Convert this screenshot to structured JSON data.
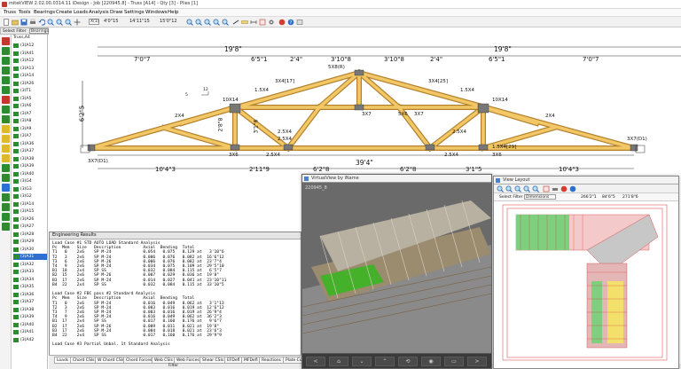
{
  "window": {
    "title": "mitekVIEW 2.02.00.0314.11 iDesign - Job [220945.8] - Truss [A14] - Qty [3] - Plies [1]"
  },
  "menu": [
    "Truss",
    "Tools",
    "Bearings",
    "Create",
    "Loads",
    "Analysis",
    "Draw",
    "Settings",
    "Windows",
    "Help"
  ],
  "toolbar": {
    "view": "X(1)",
    "coord_x": "4'0\"15",
    "coord_y": "14'11\"15",
    "coord_z": "15'0\"12"
  },
  "select_filter": {
    "label": "Select Filter",
    "value": "Bearings"
  },
  "tree": {
    "root": "Truss,A4",
    "items": [
      "(3)A12",
      "(3)A41",
      "(3)A12",
      "(3)A13",
      "(3)A14",
      "(3)A26",
      "(3)T1",
      "(3)A5",
      "(3)A6",
      "(3)A7",
      "(3)A8",
      "(3)A9",
      "(3)A7",
      "(3)A36",
      "(3)A37",
      "(3)A38",
      "(3)A39",
      "(3)A40",
      "(3)G4",
      "(3)G3",
      "(3)G2",
      "(3)A14",
      "(3)A15",
      "(3)A26",
      "(3)A27",
      "(3)A28",
      "(3)A29",
      "(3)A30",
      "(3)A31",
      "(3)A32",
      "(3)A33",
      "(3)A34",
      "(3)A35",
      "(3)A36",
      "(3)A37",
      "(3)A38",
      "(3)A39",
      "(3)A40",
      "(3)A41",
      "(3)A42"
    ],
    "selected_index": 28,
    "selected_label": "(3)A14"
  },
  "drawing": {
    "top_dims_left": [
      "19'8\"",
      "7'0\"7",
      "6'5\"1",
      "2'4\"",
      "3'10\"8"
    ],
    "top_dims_right": [
      "19'8\"",
      "3'10\"8",
      "2'4\"",
      "6'5\"1",
      "7'0\"7"
    ],
    "overall_bottom": "39'4\"",
    "bottom_dims": [
      "10'4\"3",
      "2'11\"9",
      "6'2\"8",
      "6'2\"8",
      "3'1\"5",
      "10'4\"3"
    ],
    "height_left": "6'2\"5",
    "height_inner": "2'8\"8",
    "height_mid": "3'1\"6",
    "pitch": "12",
    "pitch_rise": "5",
    "plates": [
      "5X8(R)",
      "3X4[17]",
      "3X4[25]",
      "1.5X4",
      "1.5X4",
      "10X14",
      "10X14",
      "2X4",
      "2X4",
      "3X7",
      "5X6",
      "3X7",
      "2.5X4",
      "2.5X4",
      "2.5X4",
      "2.5X4",
      "2.5X4",
      "3X6",
      "3X6",
      "1.5X4[29]",
      "3X7(D1)",
      "3X7(D1)"
    ]
  },
  "results": {
    "title": "Engineering Results",
    "text": "Load Case #1 STD AUTO LOAD Standard Analysis\nPc  Mem   Size   Description         Axial  Bending  Total\nT1   0    2x6    SP M-24             0.054   0.075   0.129 at   3'10\"6\nT2   3    2x6    SP M-24             0.006   0.076   0.082 at  16'6\"12\nT3   6    2x6    SP M-26             0.006   0.076   0.082 at  23'7\"4\nT4   9    2x6    SP M-24             0.034   0.075   0.109 at  29'5\"10\nB1  18    2x4    SP SS               0.032   0.084   0.115 at   6'5\"7\nB2  15    2x6    SP M-26             0.007   0.029   0.036 at  19'8\"\nB3  17    2x6    SP M-24             0.014   0.027   0.041 at  23'10\"11\nB4  22    2x4    SP SS               0.032   0.084   0.115 at  33'10\"5\n\nLoad Case #2 FBC pass #2 Standard Analysis\nPc  Mem   Size   Description         Axial  Bending  Total\nT1   0    2x6    SP M-24             0.016   0.049   0.062 at   3'1\"13\nT2   3    2x6    SP M-24             0.003   0.016   0.019 at  12'6\"12\nT3   7    2x6    SP M-24             0.003   0.016   0.019 at  26'9\"4\nT4   9    2x6    SP M-24             0.016   0.049   0.062 at  36'2\"3\nB1  17    2x4    SP SS               0.017   0.160   0.176 at   9'6\"7\nB2  17    2x6    SP M-26             0.009   0.011   0.021 at  19'8\"\nB3  17    2x6    SP M-24             0.004   0.018   0.021 at  23'6\"3\nB4  22    2x4    SP SS               0.017   0.160   0.176 at  29'9\"9\n\nLoad Case #3 Partial Unbal. 1t Standard Analysis"
  },
  "tabs": [
    "Loads",
    "Chord CSIs",
    "W Chord CSIs",
    "Chord Forces",
    "Web CSIs",
    "Web Forces",
    "Shear CSIs",
    "EFDefl",
    "MFDefl",
    "Reactions",
    "Plate Co"
  ],
  "status": {
    "filter": "Filter"
  },
  "virtual_view": {
    "title": "VirtualView by iName",
    "job_label": "220945_8"
  },
  "layout_view": {
    "title": "View Layout",
    "filter_label": "Select Filter",
    "filter_value": "Dimensions",
    "coord_x": "266'2\"1",
    "coord_y": "84'6\"5",
    "coord_z": "271'8\"6"
  }
}
